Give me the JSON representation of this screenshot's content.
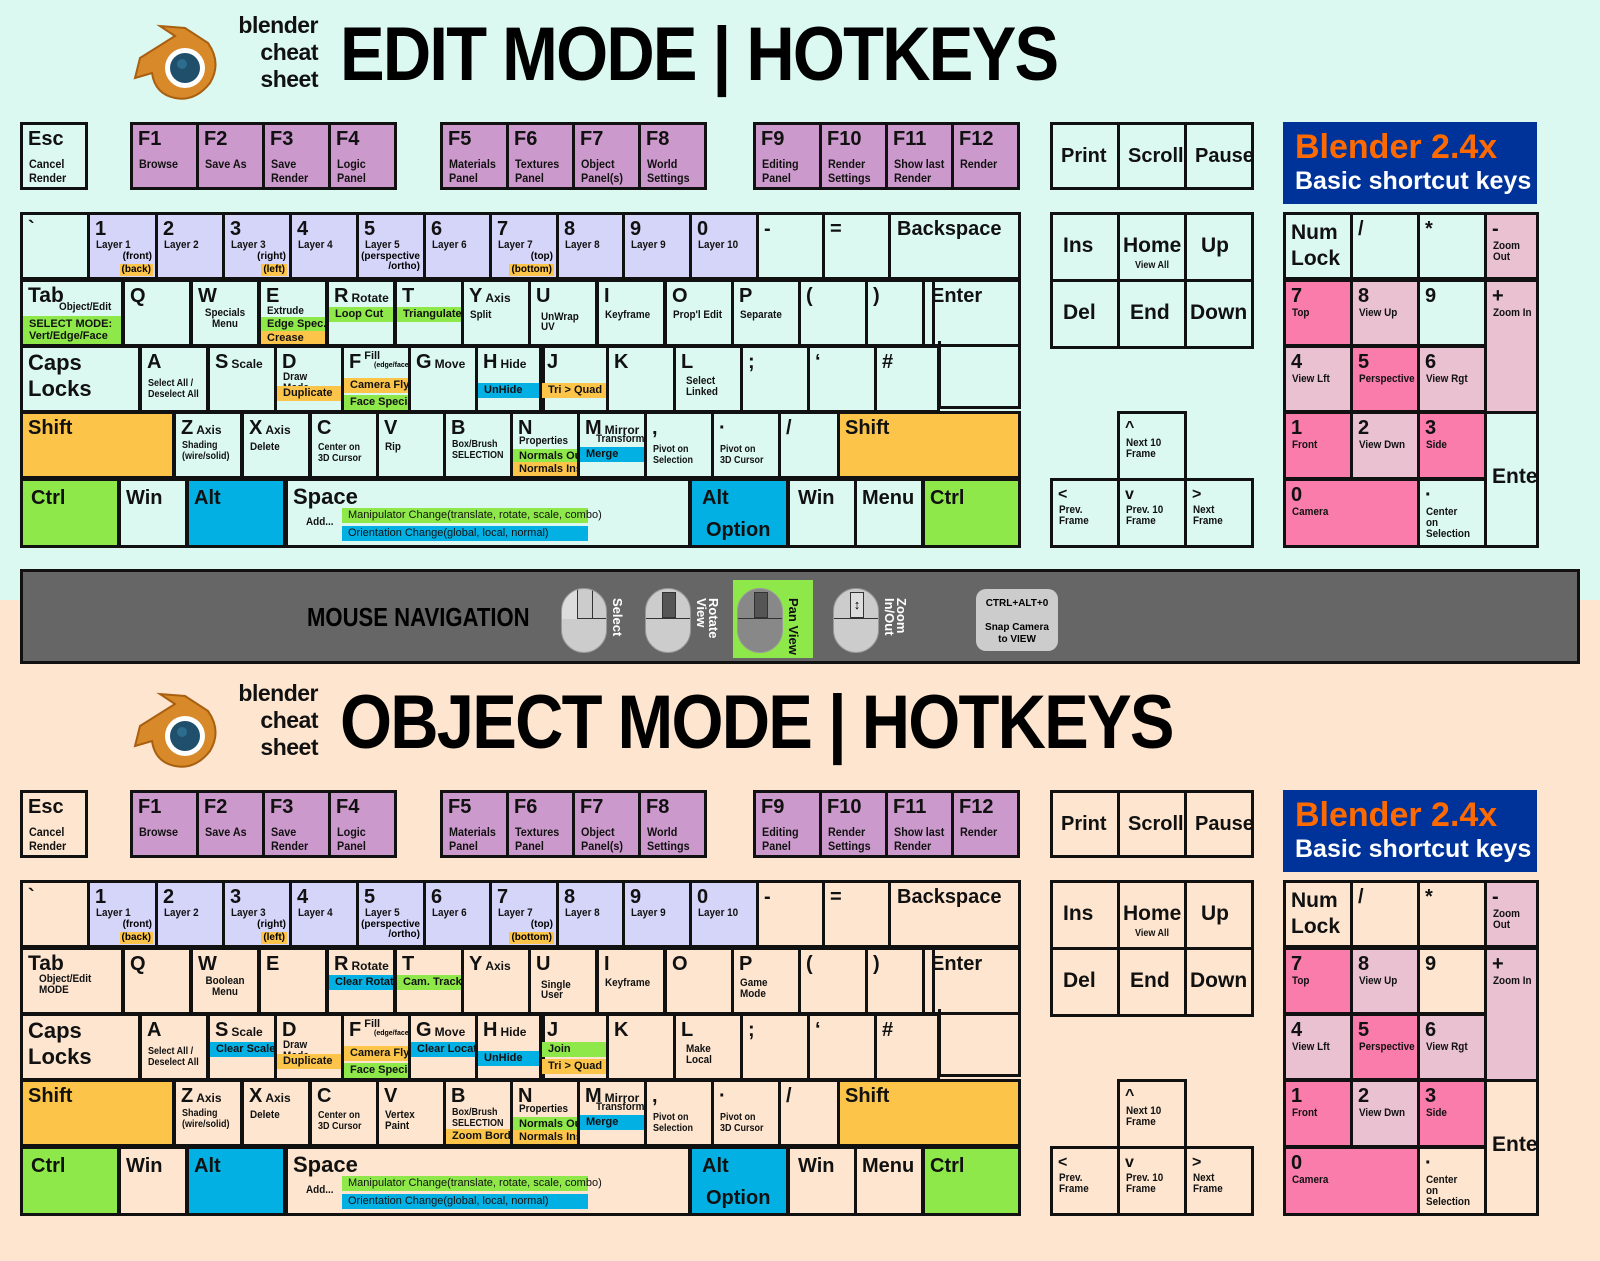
{
  "colors": {
    "edit_bg": "#dcf9f1",
    "object_bg": "#fde5cf",
    "fkey": "#cc99cc",
    "layer": "#d5d4f9",
    "shift": "#fcc54a",
    "ctrl": "#8ee84a",
    "alt": "#03b0e4",
    "numpad_strong": "#f97caa",
    "numpad_light": "#e9c1d1",
    "brand_box": "#003399",
    "brand_orange": "#ff6a00"
  },
  "brand": [
    "blender",
    "cheat",
    "sheet"
  ],
  "sections": [
    {
      "id": "edit",
      "title": "EDIT MODE | HOTKEYS",
      "tab_sub": "Object/Edit",
      "tab_band": "SELECT MODE: Vert/Edge/Face",
      "w_sub": "Specials\nMenu",
      "e_sub": "Extrude",
      "e_bands": [
        [
          "green",
          "Edge Spec."
        ],
        [
          "orange",
          "Crease"
        ]
      ],
      "r_band": [
        "green",
        "Loop Cut"
      ],
      "t_band": [
        "green",
        "Triangulate"
      ],
      "y_sub": "Split",
      "u_sub": "UnWrap\nUV",
      "o_sub": "Prop'l Edit",
      "p_sub": "Separate",
      "s_band": null,
      "g_band": null,
      "j_bands": [
        [
          "orange",
          "Tri > Quad"
        ]
      ],
      "l_sub": "Select\nLinked",
      "v_sub": "Rip",
      "b_band": null
    },
    {
      "id": "object",
      "title": "OBJECT MODE | HOTKEYS",
      "tab_sub": "Object/Edit\nMODE",
      "tab_band": null,
      "w_sub": "Boolean\nMenu",
      "e_sub": "",
      "e_bands": [],
      "r_band": [
        "blue",
        "Clear Rotat."
      ],
      "t_band": [
        "green",
        "Cam. Track"
      ],
      "y_sub": "",
      "u_sub": "Single\nUser",
      "o_sub": "",
      "p_sub": "Game Mode",
      "s_band": [
        "blue",
        "Clear Scale"
      ],
      "g_band": [
        "blue",
        "Clear Locat."
      ],
      "j_bands": [
        [
          "green",
          "Join"
        ],
        [
          "orange",
          "Tri > Quad"
        ]
      ],
      "l_sub": "Make\nLocal",
      "v_sub": "Vertex\nPaint",
      "b_band": [
        "orange",
        "Zoom Border"
      ]
    }
  ],
  "common": {
    "esc": {
      "label": "Esc",
      "sub": "Cancel\nRender"
    },
    "fkeys": [
      {
        "label": "F1",
        "sub": "Browse"
      },
      {
        "label": "F2",
        "sub": "Save As"
      },
      {
        "label": "F3",
        "sub": "Save\nRender"
      },
      {
        "label": "F4",
        "sub": "Logic\nPanel"
      },
      {
        "label": "F5",
        "sub": "Materials\nPanel"
      },
      {
        "label": "F6",
        "sub": "Textures\nPanel"
      },
      {
        "label": "F7",
        "sub": "Object\nPanel(s)"
      },
      {
        "label": "F8",
        "sub": "World\nSettings"
      },
      {
        "label": "F9",
        "sub": "Editing\nPanel"
      },
      {
        "label": "F10",
        "sub": "Render\nSettings"
      },
      {
        "label": "F11",
        "sub": "Show last\nRender"
      },
      {
        "label": "F12",
        "sub": "Render"
      }
    ],
    "sys": [
      "Print",
      "Scroll",
      "Pause"
    ],
    "number_row": [
      {
        "label": "`",
        "sub": ""
      },
      {
        "label": "1",
        "sub": "Layer 1",
        "note": "(front)",
        "tag": "(back)"
      },
      {
        "label": "2",
        "sub": "Layer 2"
      },
      {
        "label": "3",
        "sub": "Layer 3",
        "note": "(right)",
        "tag": "(left)"
      },
      {
        "label": "4",
        "sub": "Layer 4"
      },
      {
        "label": "5",
        "sub": "Layer 5",
        "note": "(perspective\n/ortho)"
      },
      {
        "label": "6",
        "sub": "Layer 6"
      },
      {
        "label": "7",
        "sub": "Layer 7",
        "note": "(top)",
        "tag": "(bottom)"
      },
      {
        "label": "8",
        "sub": "Layer 8"
      },
      {
        "label": "9",
        "sub": "Layer 9"
      },
      {
        "label": "0",
        "sub": "Layer 10"
      },
      {
        "label": "-",
        "sub": ""
      },
      {
        "label": "=",
        "sub": ""
      },
      {
        "label": "Backspace",
        "sub": ""
      }
    ],
    "tab": "Tab",
    "q": "Q",
    "w": "W",
    "e": "E",
    "r": "R",
    "r_inline": "Rotate",
    "t": "T",
    "y": "Y",
    "y_inline": "Axis",
    "u": "U",
    "i": "I",
    "i_sub": "Keyframe",
    "o": "O",
    "p": "P",
    "lparen": "(",
    "rparen": ")",
    "enter": "Enter",
    "caps": "Caps\nLocks",
    "a": "A",
    "a_sub": "Select All /\nDeselect All",
    "s": "S",
    "s_inline": "Scale",
    "d": "D",
    "d_sub": "Draw Mode",
    "d_band": "Duplicate",
    "f": "F",
    "f_inline": "Fill",
    "f_small": "(edge/face)",
    "f_bands": [
      "Camera Fly",
      "Face Specials"
    ],
    "g": "G",
    "g_inline": "Move",
    "h": "H",
    "h_inline": "Hide",
    "h_band": "UnHide",
    "j": "J",
    "k": "K",
    "l": "L",
    "semicolon": ";",
    "quote": "‘",
    "hash": "#",
    "shift": "Shift",
    "z": "Z",
    "z_inline": "Axis",
    "z_sub": "Shading\n(wire/solid)",
    "x": "X",
    "x_inline": "Axis",
    "x_sub": "Delete",
    "c": "C",
    "c_sub": "Center on\n3D Cursor",
    "v": "V",
    "b": "B",
    "b_sub": "Box/Brush",
    "b_sub2": "SELECTION",
    "n": "N",
    "n_sub": "Properties",
    "n_bands": [
      "Normals Out",
      "Normals Inside"
    ],
    "m": "M",
    "m_inline": "Mirror",
    "m_sub": "Transform",
    "m_band": "Merge",
    "comma": ",",
    "comma_sub": "Pivot on\nSelection",
    "period": "·",
    "period_sub": "Pivot on\n3D Cursor",
    "slash": "/",
    "ctrl": "Ctrl",
    "win": "Win",
    "alt": "Alt",
    "alt_sub": "Option",
    "space": "Space",
    "space_add": "Add...",
    "space_manip": "Manipulator Change(translate, rotate, scale, combo)",
    "space_orient": "Orientation Change(global, local, normal)",
    "menu": "Menu",
    "nav": [
      {
        "label": "Ins"
      },
      {
        "label": "Home",
        "sub": "View All"
      },
      {
        "label": "Up"
      },
      {
        "label": "Del"
      },
      {
        "label": "End"
      },
      {
        "label": "Down"
      }
    ],
    "arrows": {
      "up": {
        "label": "^",
        "sub": "Next 10\nFrame"
      },
      "left": {
        "label": "<",
        "sub": "Prev.\nFrame"
      },
      "down": {
        "label": "v",
        "sub": "Prev. 10\nFrame"
      },
      "right": {
        "label": ">",
        "sub": "Next\nFrame"
      }
    },
    "blender_box": {
      "line1": "Blender 2.4x",
      "line2": "Basic shortcut keys"
    },
    "numpad": {
      "numlock": "Num\nLock",
      "div": "/",
      "mul": "*",
      "minus": "-",
      "minus_sub": "Zoom Out",
      "plus": "+",
      "plus_sub": "Zoom In",
      "n7": "7",
      "n7_sub": "Top",
      "n8": "8",
      "n8_sub": "View Up",
      "n9": "9",
      "n4": "4",
      "n4_sub": "View Lft",
      "n5": "5",
      "n5_sub": "Perspective",
      "n6": "6",
      "n6_sub": "View Rgt",
      "n1": "1",
      "n1_sub": "Front",
      "n2": "2",
      "n2_sub": "View Dwn",
      "n3": "3",
      "n3_sub": "Side",
      "n0": "0",
      "n0_sub": "Camera",
      "dot": "·",
      "dot_sub": "Center\non Selection",
      "enter": "Enter"
    }
  },
  "mouse_nav": {
    "label": "MOUSE NAVIGATION",
    "buttons": [
      {
        "name": "Select",
        "highlight": false
      },
      {
        "name": "Rotate\nView",
        "highlight": false
      },
      {
        "name": "Pan\nView",
        "highlight": true
      },
      {
        "name": "Zoom\nIn/Out",
        "highlight": false
      }
    ],
    "snap": "CTRL+ALT+0\n\nSnap Camera\nto VIEW"
  }
}
